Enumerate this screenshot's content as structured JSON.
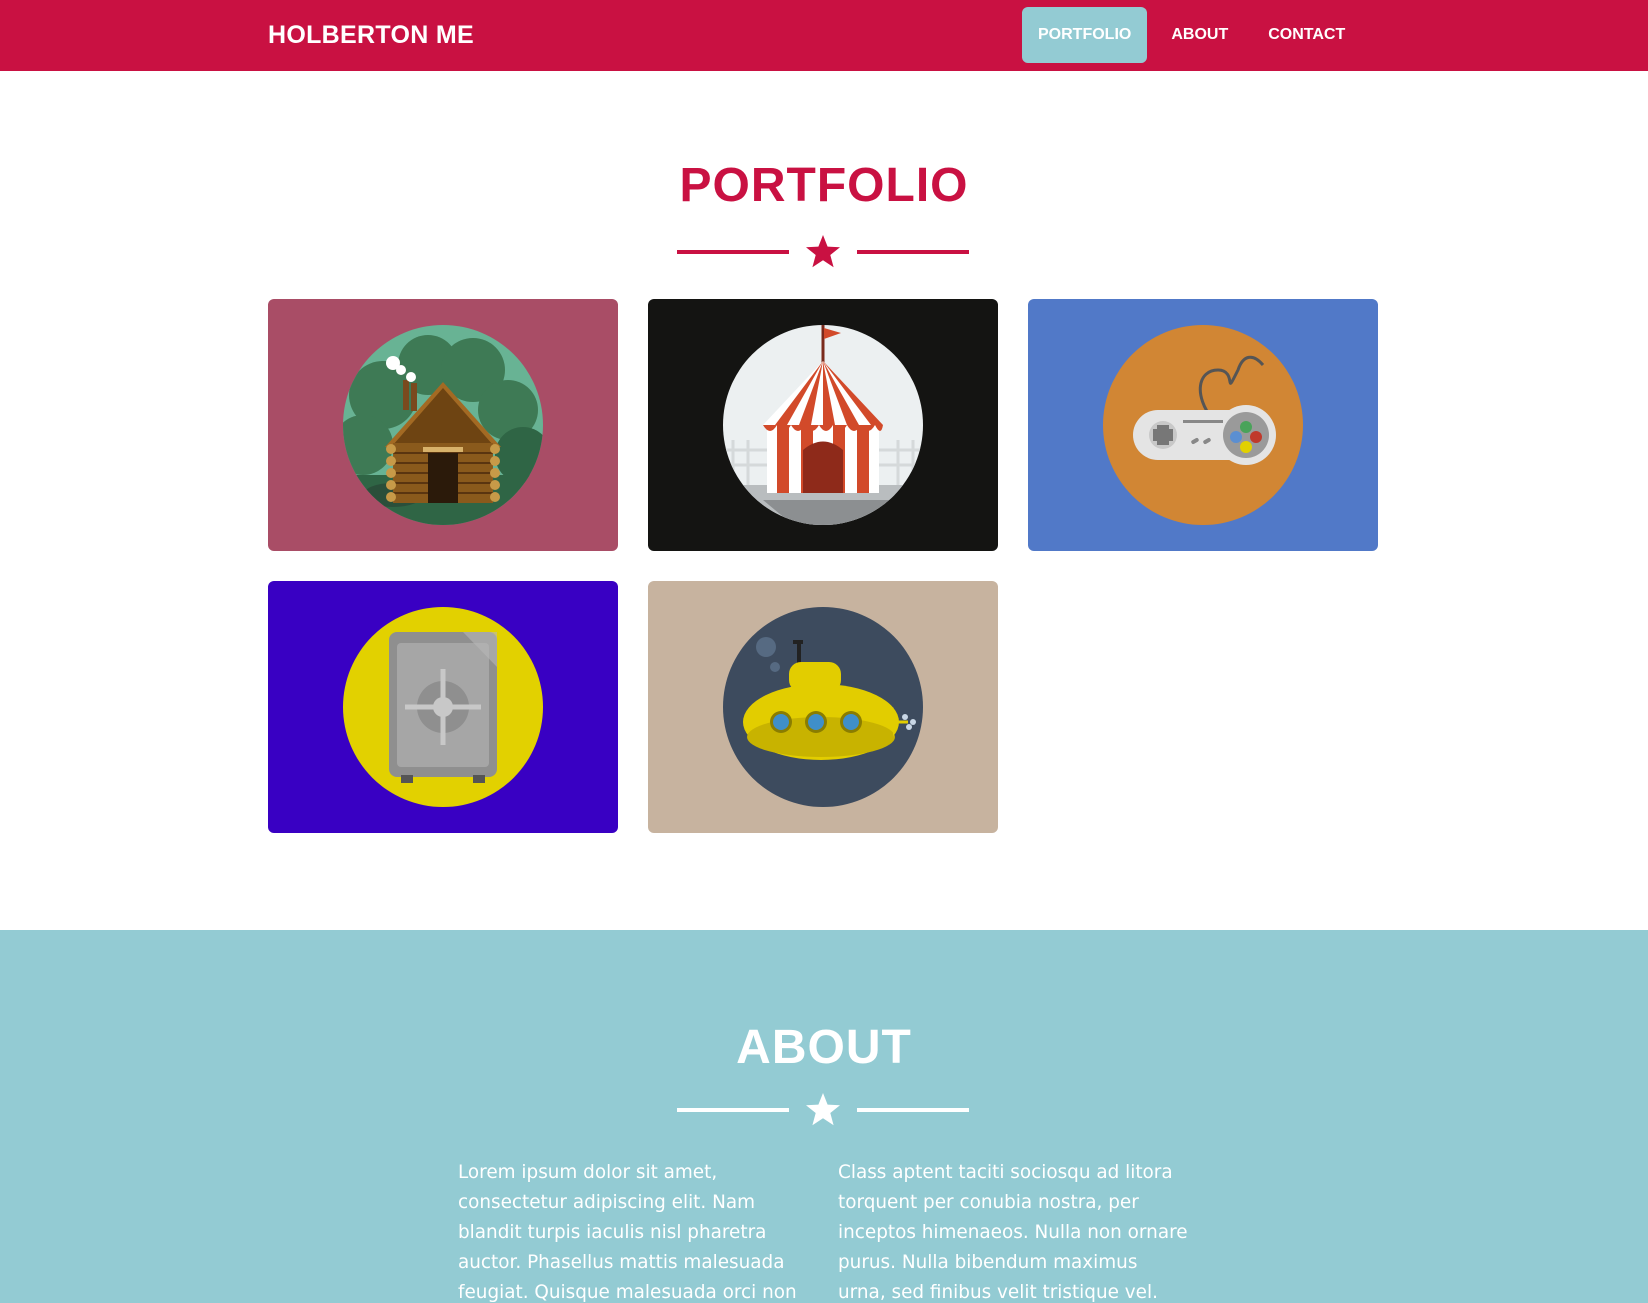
{
  "nav": {
    "brand": "HOLBERTON ME",
    "links": [
      {
        "label": "PORTFOLIO",
        "active": true
      },
      {
        "label": "ABOUT",
        "active": false
      },
      {
        "label": "CONTACT",
        "active": false
      }
    ],
    "colors": {
      "bar": "#c91142",
      "active_pill": "#93cbd3"
    }
  },
  "portfolio": {
    "title": "PORTFOLIO",
    "divider_icon": "star-icon",
    "items": [
      {
        "icon": "log-cabin-icon",
        "background": "#a94d66",
        "circle": "#68b394"
      },
      {
        "icon": "circus-tent-icon",
        "background": "#141412",
        "circle": "#ecf0f1"
      },
      {
        "icon": "game-controller-icon",
        "background": "#5179c8",
        "circle": "#d18634"
      },
      {
        "icon": "safe-icon",
        "background": "#3900c3",
        "circle": "#e2d100"
      },
      {
        "icon": "submarine-icon",
        "background": "#c7b39f",
        "circle": "#3d4b5e"
      }
    ]
  },
  "about": {
    "title": "ABOUT",
    "divider_icon": "star-icon",
    "background": "#93cbd3",
    "col1": "Lorem ipsum dolor sit amet, consectetur adipiscing elit. Nam blandit turpis iaculis nisl pharetra auctor. Phasellus mattis malesuada feugiat. Quisque malesuada orci non risus scelerisque bibendum.",
    "col2": "Class aptent taciti sociosqu ad litora torquent per conubia nostra, per inceptos himenaeos. Nulla non ornare purus. Nulla bibendum maximus urna, sed finibus velit tristique vel. Vivamus"
  }
}
